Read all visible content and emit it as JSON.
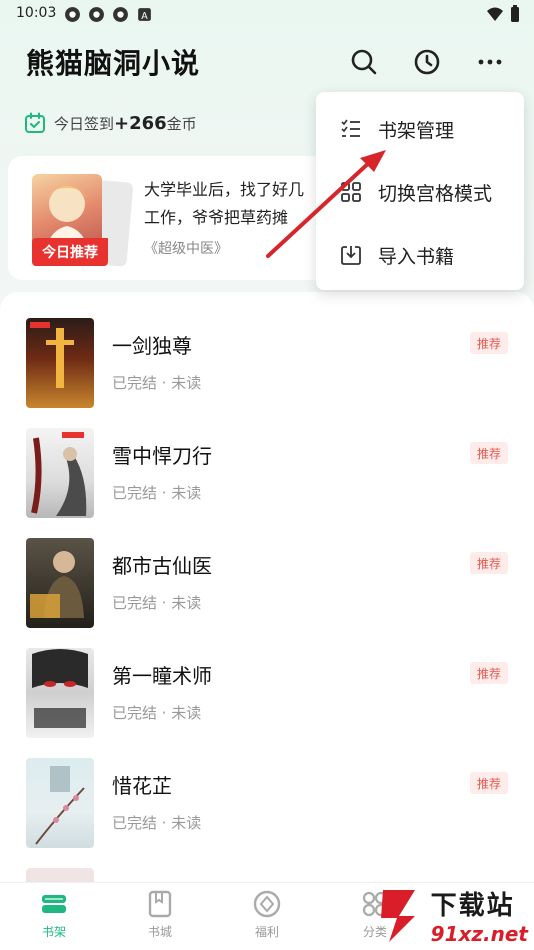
{
  "status_bar": {
    "time": "10:03"
  },
  "header": {
    "title": "熊猫脑洞小说"
  },
  "checkin": {
    "text": "今日签到",
    "amount": "+266",
    "unit": "金币"
  },
  "recommend": {
    "badge": "今日推荐",
    "desc": "大学毕业后，找了好几份工作，爷爷把草药摊子",
    "desc_line1": "大学毕业后，找了好几",
    "desc_line2": "工作，爷爷把草药摊",
    "source": "《超级中医》"
  },
  "menu": {
    "items": [
      {
        "label": "书架管理",
        "icon": "list-check-icon"
      },
      {
        "label": "切换宫格模式",
        "icon": "grid-icon"
      },
      {
        "label": "导入书籍",
        "icon": "import-icon"
      }
    ]
  },
  "books": [
    {
      "title": "一剑独尊",
      "status": "已完结 · 未读",
      "tag": "推荐"
    },
    {
      "title": "雪中悍刀行",
      "status": "已完结 · 未读",
      "tag": "推荐"
    },
    {
      "title": "都市古仙医",
      "status": "已完结 · 未读",
      "tag": "推荐"
    },
    {
      "title": "第一瞳术师",
      "status": "已完结 · 未读",
      "tag": "推荐"
    },
    {
      "title": "惜花芷",
      "status": "已完结 · 未读",
      "tag": "推荐"
    }
  ],
  "bottom_nav": [
    {
      "label": "书架",
      "icon": "bookshelf-icon",
      "active": true
    },
    {
      "label": "书城",
      "icon": "bookstore-icon",
      "active": false
    },
    {
      "label": "福利",
      "icon": "welfare-icon",
      "active": false
    },
    {
      "label": "分类",
      "icon": "category-icon",
      "active": false
    }
  ],
  "watermark": {
    "top": "下载站",
    "bottom": "91xz.net"
  },
  "colors": {
    "accent": "#1fb883",
    "tag_red": "#e55a52",
    "badge_red": "#e8322f",
    "arrow_red": "#d7262b"
  }
}
